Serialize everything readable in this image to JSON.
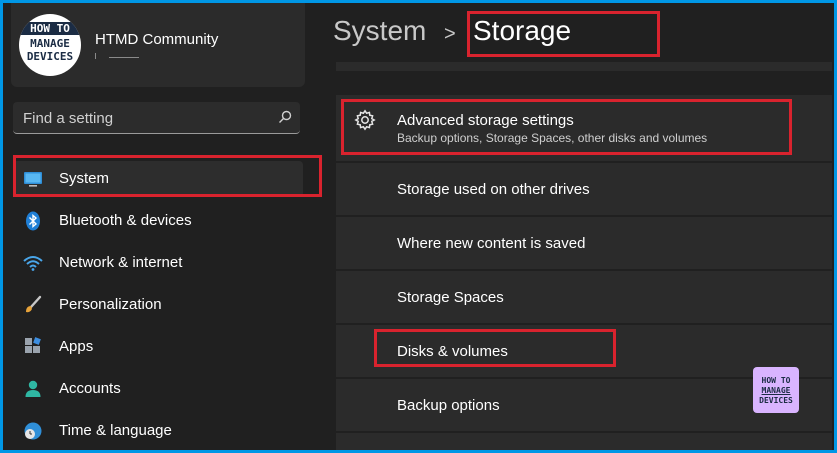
{
  "profile": {
    "logo_lines": [
      "HOW TO",
      "MANAGE",
      "DEVICES"
    ],
    "name": "HTMD Community"
  },
  "search": {
    "placeholder": "Find a setting"
  },
  "sidebar": {
    "items": [
      {
        "label": "System",
        "icon": "monitor-icon",
        "selected": true
      },
      {
        "label": "Bluetooth & devices",
        "icon": "bluetooth-icon"
      },
      {
        "label": "Network & internet",
        "icon": "wifi-icon"
      },
      {
        "label": "Personalization",
        "icon": "brush-icon"
      },
      {
        "label": "Apps",
        "icon": "apps-icon"
      },
      {
        "label": "Accounts",
        "icon": "person-icon"
      },
      {
        "label": "Time & language",
        "icon": "globe-clock-icon"
      }
    ]
  },
  "header": {
    "breadcrumb_parent": "System",
    "separator": ">",
    "breadcrumb_current": "Storage"
  },
  "settings": {
    "advanced": {
      "title": "Advanced storage settings",
      "subtitle": "Backup options, Storage Spaces, other disks and volumes",
      "icon": "gear-icon"
    },
    "sub_items": [
      "Storage used on other drives",
      "Where new content is saved",
      "Storage Spaces",
      "Disks & volumes",
      "Backup options"
    ]
  },
  "watermark": {
    "lines": [
      "HOW TO",
      "MANAGE",
      "DEVICES"
    ]
  },
  "colors": {
    "background": "#202020",
    "card": "#2b2b2b",
    "accent": "#4cc2ff",
    "highlight": "#d9232e",
    "frame": "#0097e6"
  }
}
